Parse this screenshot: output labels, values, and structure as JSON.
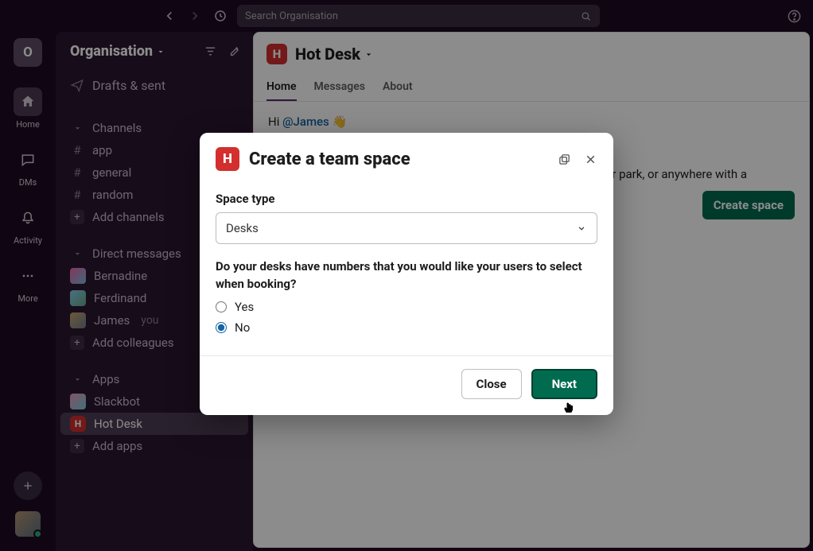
{
  "topbar": {
    "search_placeholder": "Search Organisation"
  },
  "rail": {
    "workspace_initial": "O",
    "items": [
      {
        "label": "Home"
      },
      {
        "label": "DMs"
      },
      {
        "label": "Activity"
      },
      {
        "label": "More"
      }
    ]
  },
  "sidebar": {
    "workspace": "Organisation",
    "drafts": "Drafts & sent",
    "channels_header": "Channels",
    "channels": [
      "app",
      "general",
      "random"
    ],
    "add_channels": "Add channels",
    "dm_header": "Direct messages",
    "dms": [
      {
        "name": "Bernadine"
      },
      {
        "name": "Ferdinand"
      },
      {
        "name": "James",
        "you": "you"
      }
    ],
    "add_colleagues": "Add colleagues",
    "apps_header": "Apps",
    "apps": [
      {
        "name": "Slackbot"
      },
      {
        "name": "Hot Desk"
      }
    ],
    "add_apps": "Add apps"
  },
  "main": {
    "title": "Hot Desk",
    "tabs": {
      "home": "Home",
      "messages": "Messages",
      "about": "About"
    },
    "greeting_prefix": "Hi ",
    "greeting_mention": "@James",
    "greeting_wave": " 👋",
    "line2_tail": "r park, or anywhere with a",
    "cta": "Create space"
  },
  "modal": {
    "title": "Create a team space",
    "space_type_label": "Space type",
    "space_type_value": "Desks",
    "question": "Do your desks have numbers that you would like your users to select when booking?",
    "yes": "Yes",
    "no": "No",
    "close": "Close",
    "next": "Next"
  }
}
